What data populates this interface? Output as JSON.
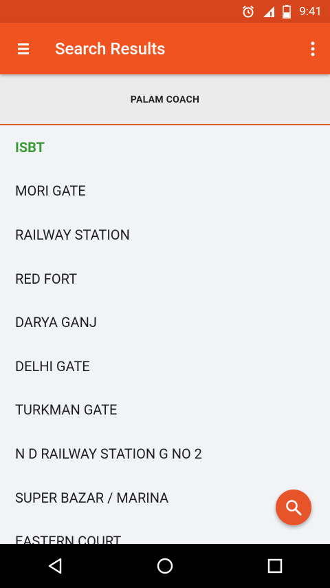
{
  "status_bar": {
    "time": "9:41",
    "icons": [
      "alarm-icon",
      "signal-icon",
      "battery-icon"
    ]
  },
  "app_bar": {
    "title": "Search Results",
    "menu_icon": "hamburger-menu-icon",
    "overflow_icon": "more-vert-icon"
  },
  "tab": {
    "label": "PALAM COACH",
    "indicator_color": "#e0542a"
  },
  "stops": [
    "ISBT",
    "MORI GATE",
    "RAILWAY STATION",
    "RED FORT",
    "DARYA GANJ",
    "DELHI GATE",
    "TURKMAN GATE",
    "N D RAILWAY STATION G NO 2",
    "SUPER BAZAR / MARINA",
    "EASTERN COURT"
  ],
  "fab": {
    "icon": "search-icon"
  },
  "nav_bar": {
    "icons": [
      "back-icon",
      "home-icon",
      "recents-icon"
    ]
  },
  "colors": {
    "primary": "#f0531f",
    "status_bar": "#d6451b",
    "first_item": "#3a9b35",
    "fab": "#e8542a"
  }
}
